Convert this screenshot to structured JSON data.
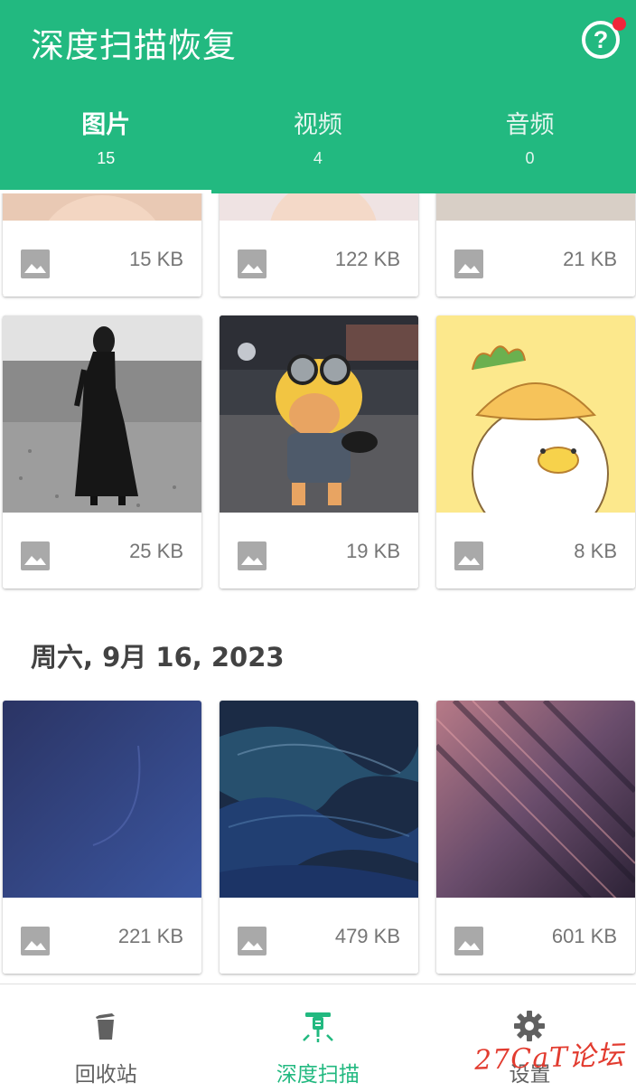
{
  "header": {
    "title": "深度扫描恢复",
    "help_symbol": "?"
  },
  "tabs": [
    {
      "label": "图片",
      "count": "15",
      "active": true
    },
    {
      "label": "视频",
      "count": "4",
      "active": false
    },
    {
      "label": "音频",
      "count": "0",
      "active": false
    }
  ],
  "date_groups": [
    {
      "date": "周六, 9月 16, 2023"
    }
  ],
  "cards": [
    {
      "size": "15 KB",
      "content": "portrait-crop"
    },
    {
      "size": "122 KB",
      "content": "child-crop"
    },
    {
      "size": "21 KB",
      "content": "sweater-crop"
    },
    {
      "size": "25 KB",
      "content": "woman-beach-bw"
    },
    {
      "size": "19 KB",
      "content": "cat-minion-costume"
    },
    {
      "size": "8 KB",
      "content": "cartoon-duck-pineapple"
    },
    {
      "size": "221 KB",
      "content": "wallpaper-blue"
    },
    {
      "size": "479 KB",
      "content": "wallpaper-wave"
    },
    {
      "size": "601 KB",
      "content": "wallpaper-streaks"
    }
  ],
  "bottom_nav": [
    {
      "label": "回收站",
      "icon": "trash-icon",
      "active": false
    },
    {
      "label": "深度扫描",
      "icon": "jackhammer-icon",
      "active": true
    },
    {
      "label": "设置",
      "icon": "gear-icon",
      "active": false
    }
  ],
  "watermark": "27CaT论坛",
  "colors": {
    "primary": "#22b980",
    "text_dark": "#424242",
    "text_gray": "#757575",
    "badge_red": "#f0263a",
    "watermark_red": "#e23b2f"
  }
}
